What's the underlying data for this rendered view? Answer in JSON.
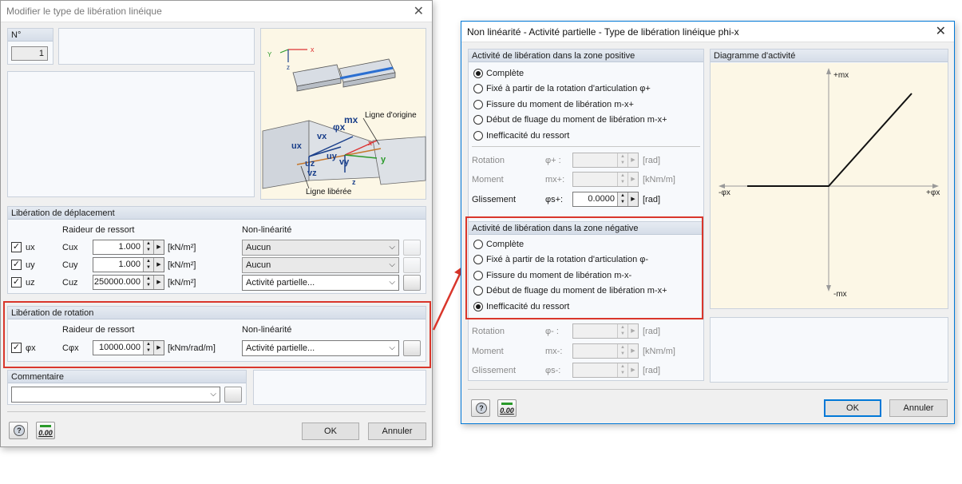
{
  "left_dialog": {
    "title": "Modifier le type de libération linéique",
    "no_label": "N°",
    "no_value": "1",
    "figure": {
      "ligne_origine": "Ligne d'origine",
      "ligne_liberee": "Ligne libérée"
    },
    "displacement": {
      "header": "Libération de déplacement",
      "col_stiffness": "Raideur de ressort",
      "col_nonlin": "Non-linéarité",
      "rows": [
        {
          "dir": "ux",
          "coef": "Cux",
          "value": "1.000",
          "unit": "[kN/m²]",
          "nonlin": "Aucun"
        },
        {
          "dir": "uy",
          "coef": "Cuy",
          "value": "1.000",
          "unit": "[kN/m²]",
          "nonlin": "Aucun"
        },
        {
          "dir": "uz",
          "coef": "Cuz",
          "value": "250000.000",
          "unit": "[kN/m²]",
          "nonlin": "Activité partielle..."
        }
      ]
    },
    "rotation": {
      "header": "Libération de rotation",
      "col_stiffness": "Raideur de ressort",
      "col_nonlin": "Non-linéarité",
      "row": {
        "dir": "φx",
        "coef": "Cφx",
        "value": "10000.000",
        "unit": "[kNm/rad/m]",
        "nonlin": "Activité partielle..."
      }
    },
    "comment": {
      "header": "Commentaire",
      "value": ""
    },
    "ok": "OK",
    "cancel": "Annuler",
    "num_icon": "0.00"
  },
  "right_dialog": {
    "title": "Non linéarité - Activité partielle - Type de libération linéique phi-x",
    "positive": {
      "header": "Activité de libération dans la zone positive",
      "options": [
        "Complète",
        "Fixé à partir de la rotation d'articulation φ+",
        "Fissure du moment de libération m-x+",
        "Début de fluage du moment de libération m-x+",
        "Inefficacité du ressort"
      ],
      "selected": 0,
      "params": [
        {
          "label": "Rotation",
          "sym": "φ+ :",
          "value": "",
          "unit": "[rad]",
          "enabled": false
        },
        {
          "label": "Moment",
          "sym": "mx+:",
          "value": "",
          "unit": "[kNm/m]",
          "enabled": false
        },
        {
          "label": "Glissement",
          "sym": "φs+:",
          "value": "0.0000",
          "unit": "[rad]",
          "enabled": true
        }
      ]
    },
    "negative": {
      "header": "Activité de libération dans la zone négative",
      "options": [
        "Complète",
        "Fixé à partir de la rotation d'articulation φ-",
        "Fissure du moment de libération m-x-",
        "Début de fluage du moment de libération m-x+",
        "Inefficacité du ressort"
      ],
      "selected": 4,
      "params": [
        {
          "label": "Rotation",
          "sym": "φ- :",
          "value": "",
          "unit": "[rad]",
          "enabled": false
        },
        {
          "label": "Moment",
          "sym": "mx-:",
          "value": "",
          "unit": "[kNm/m]",
          "enabled": false
        },
        {
          "label": "Glissement",
          "sym": "φs-:",
          "value": "",
          "unit": "[rad]",
          "enabled": false
        }
      ]
    },
    "diagram": {
      "header": "Diagramme d'activité",
      "pos_y": "+mx",
      "neg_y": "-mx",
      "pos_x": "+φx",
      "neg_x": "-φx"
    },
    "ok": "OK",
    "cancel": "Annuler",
    "num_icon": "0.00"
  },
  "colors": {
    "highlight": "#d9362b",
    "title_active": "#0078d7"
  }
}
